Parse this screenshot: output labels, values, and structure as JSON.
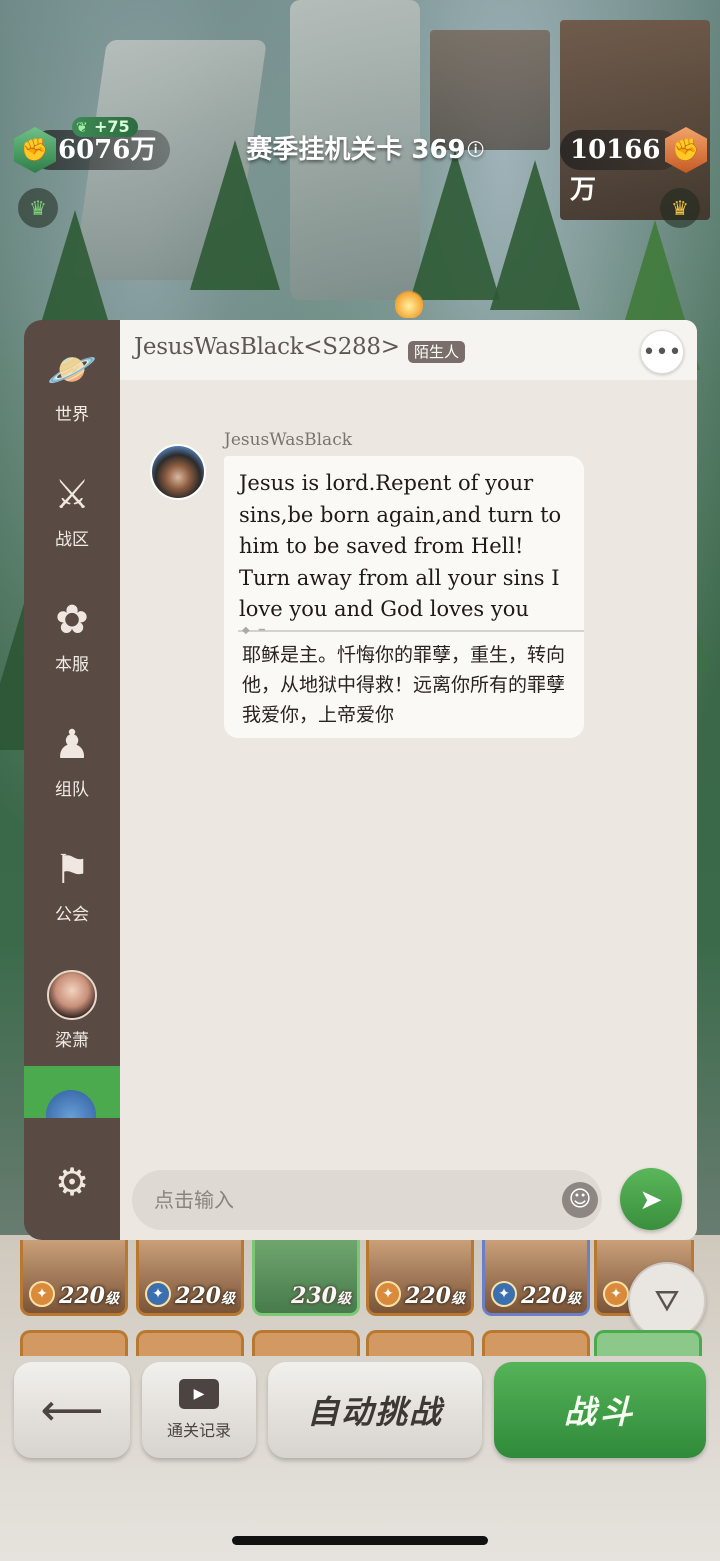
{
  "hud": {
    "power_left": "6076万",
    "power_left_bonus": "+75",
    "stage_title": "赛季挂机关卡 369",
    "power_right": "10166万"
  },
  "side_nav": {
    "items": [
      {
        "label": "世界",
        "icon": "planet-icon"
      },
      {
        "label": "战区",
        "icon": "crossed-swords-icon"
      },
      {
        "label": "本服",
        "icon": "tree-icon"
      },
      {
        "label": "组队",
        "icon": "team-icon"
      },
      {
        "label": "公会",
        "icon": "banner-icon"
      }
    ],
    "contact_label": "梁萧"
  },
  "chat": {
    "title": "JesusWasBlack<S288>",
    "badge": "陌生人",
    "message": {
      "sender": "JesusWasBlack",
      "text_en": "Jesus is lord.Repent of your sins,be born again,and turn to him to be saved from Hell! Turn away from all your sins I love you and God loves you",
      "text_cn": "耶稣是主。忏悔你的罪孽，重生，转向他，从地狱中得救！远离你所有的罪孽我爱你，上帝爱你"
    },
    "input_placeholder": "点击输入"
  },
  "heroes": [
    {
      "level": "220",
      "unit": "级"
    },
    {
      "level": "220",
      "unit": "级"
    },
    {
      "level": "230",
      "unit": "级"
    },
    {
      "level": "220",
      "unit": "级"
    },
    {
      "level": "220",
      "unit": "级"
    },
    {
      "level": "",
      "unit": ""
    }
  ],
  "actions": {
    "record_label": "通关记录",
    "auto_label": "自动挑战",
    "fight_label": "战斗"
  },
  "colors": {
    "accent_green": "#3a8f3c",
    "panel_bg": "#ece8e1",
    "nav_bg": "#5a4a44"
  }
}
